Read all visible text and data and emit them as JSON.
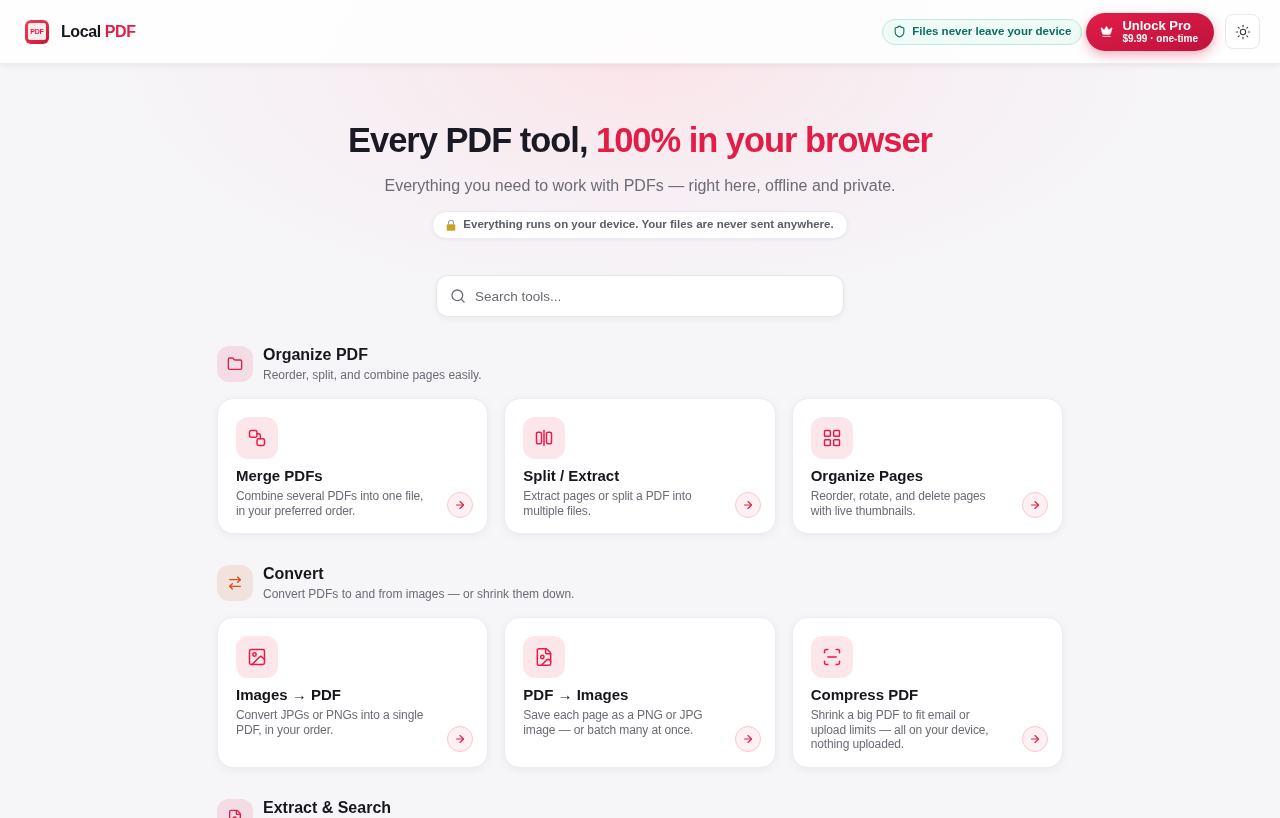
{
  "header": {
    "logo": {
      "badge": "PDF",
      "name": "Local",
      "name_highlight": "PDF"
    },
    "privacy_badge": "Files never leave your device",
    "upgrade_button": {
      "title": "Unlock Pro",
      "price": "$9.99 · one-time"
    }
  },
  "hero": {
    "title": "Every PDF tool,",
    "title_highlight": "100% in your browser",
    "subtitle": "Everything you need to work with PDFs — right here, offline and private.",
    "notice": "Everything runs on your device. Your files are never sent anywhere."
  },
  "search": {
    "placeholder": "Search tools..."
  },
  "sections": [
    {
      "title": "Organize PDF",
      "description": "Reorder, split, and combine pages easily.",
      "color": "#e11d48",
      "tools": [
        {
          "title": "Merge PDFs",
          "description": "Combine several PDFs into one file, in your preferred order."
        },
        {
          "title": "Split / Extract",
          "description": "Extract pages or split a PDF into multiple files."
        },
        {
          "title": "Organize Pages",
          "description": "Reorder, rotate, and delete pages with live thumbnails."
        }
      ]
    },
    {
      "title": "Convert",
      "description": "Convert PDFs to and from images — or shrink them down.",
      "color": "#d4511b",
      "tools": [
        {
          "title": "Images → PDF",
          "description": "Convert JPGs or PNGs into a single PDF, in your order."
        },
        {
          "title": "PDF → Images",
          "description": "Save each page as a PNG or JPG image — or batch many at once."
        },
        {
          "title": "Compress PDF",
          "description": "Shrink a big PDF to fit email or upload limits — all on your device, nothing uploaded."
        }
      ]
    },
    {
      "title": "Extract & Search",
      "color": "#e11d48"
    }
  ]
}
